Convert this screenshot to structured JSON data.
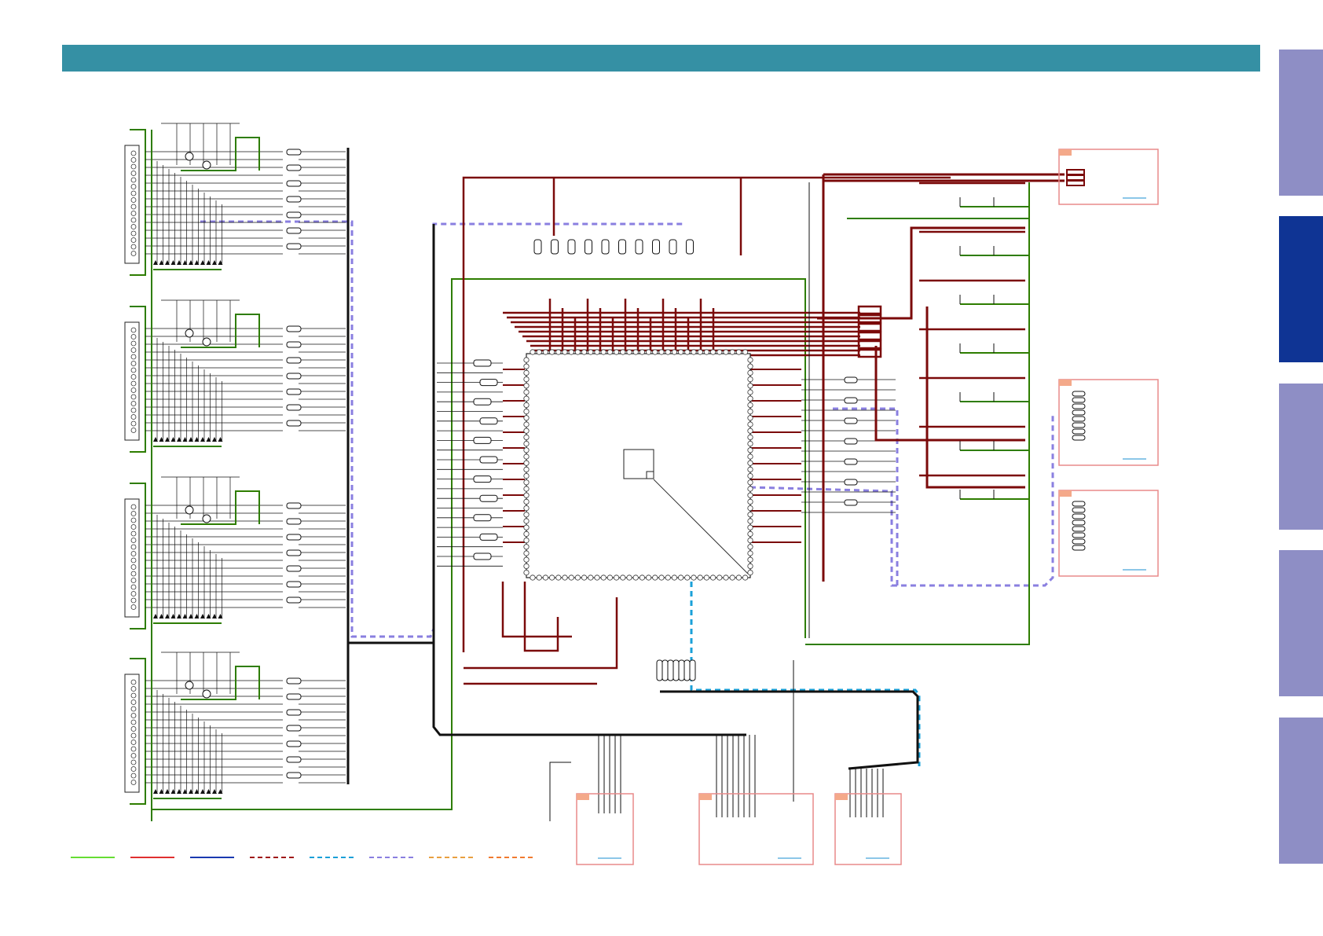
{
  "header": {
    "title": "",
    "color": "#3590a4"
  },
  "side_tabs": [
    {
      "label": "",
      "state": "inactive"
    },
    {
      "label": "",
      "state": "active"
    },
    {
      "label": "",
      "state": "inactive"
    },
    {
      "label": "",
      "state": "inactive"
    },
    {
      "label": "",
      "state": "inactive"
    }
  ],
  "colors": {
    "tab_inactive": "#8e8ec5",
    "tab_active": "#0f3494",
    "wire_green": "#2e7d00",
    "wire_dark_red": "#7b0a0a",
    "wire_black": "#111111",
    "dash_purple": "#8a7fe0",
    "dash_cyan": "#1aa0d8",
    "connector_box": "#e88a8a",
    "connector_tag": "#f4a98a",
    "link_blue": "#1a8fd0"
  },
  "legend": [
    {
      "style": "solid",
      "color": "#66dd33"
    },
    {
      "style": "solid",
      "color": "#e03030"
    },
    {
      "style": "solid",
      "color": "#1a3ab0"
    },
    {
      "style": "dashed",
      "color": "#a01818"
    },
    {
      "style": "dashed",
      "color": "#1aa0d8"
    },
    {
      "style": "dashed",
      "color": "#8a7fe0"
    },
    {
      "style": "dashed",
      "color": "#e8a040"
    },
    {
      "style": "dashed",
      "color": "#f07a30"
    }
  ]
}
